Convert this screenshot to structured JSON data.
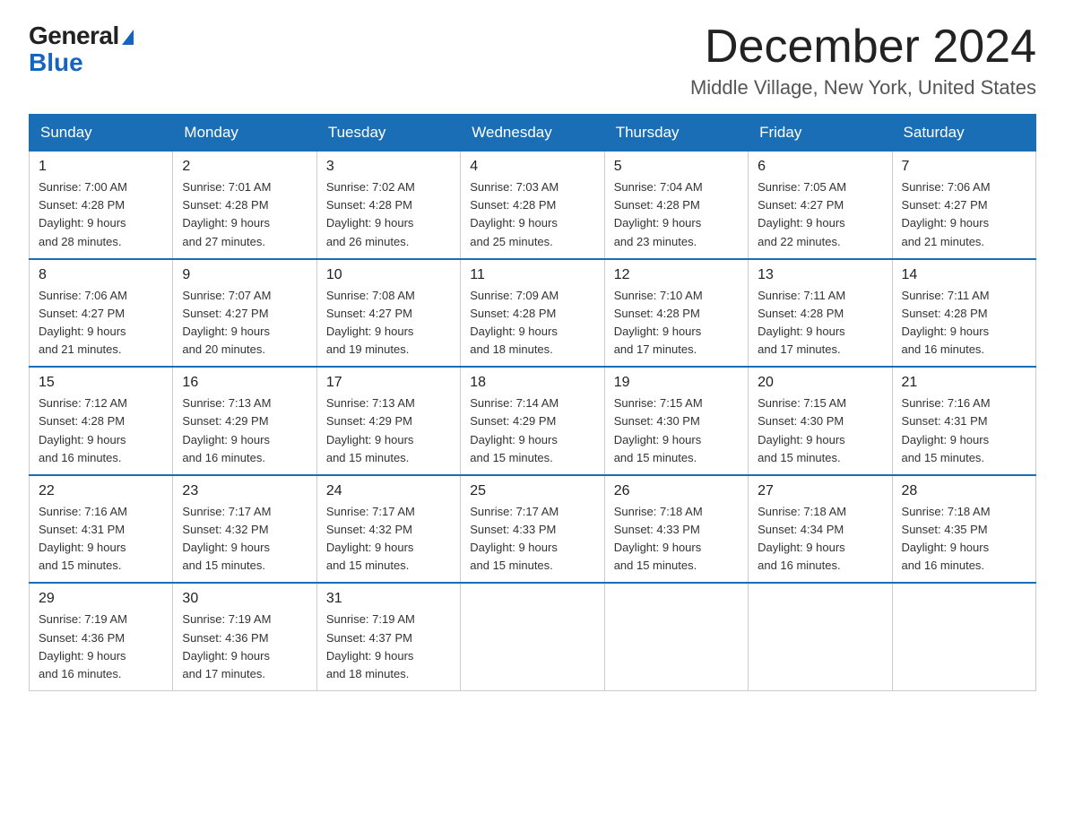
{
  "logo": {
    "general": "General",
    "triangle": "▶",
    "blue": "Blue"
  },
  "title": "December 2024",
  "subtitle": "Middle Village, New York, United States",
  "weekdays": [
    "Sunday",
    "Monday",
    "Tuesday",
    "Wednesday",
    "Thursday",
    "Friday",
    "Saturday"
  ],
  "weeks": [
    [
      {
        "day": "1",
        "sunrise": "7:00 AM",
        "sunset": "4:28 PM",
        "daylight": "9 hours and 28 minutes."
      },
      {
        "day": "2",
        "sunrise": "7:01 AM",
        "sunset": "4:28 PM",
        "daylight": "9 hours and 27 minutes."
      },
      {
        "day": "3",
        "sunrise": "7:02 AM",
        "sunset": "4:28 PM",
        "daylight": "9 hours and 26 minutes."
      },
      {
        "day": "4",
        "sunrise": "7:03 AM",
        "sunset": "4:28 PM",
        "daylight": "9 hours and 25 minutes."
      },
      {
        "day": "5",
        "sunrise": "7:04 AM",
        "sunset": "4:28 PM",
        "daylight": "9 hours and 23 minutes."
      },
      {
        "day": "6",
        "sunrise": "7:05 AM",
        "sunset": "4:27 PM",
        "daylight": "9 hours and 22 minutes."
      },
      {
        "day": "7",
        "sunrise": "7:06 AM",
        "sunset": "4:27 PM",
        "daylight": "9 hours and 21 minutes."
      }
    ],
    [
      {
        "day": "8",
        "sunrise": "7:06 AM",
        "sunset": "4:27 PM",
        "daylight": "9 hours and 21 minutes."
      },
      {
        "day": "9",
        "sunrise": "7:07 AM",
        "sunset": "4:27 PM",
        "daylight": "9 hours and 20 minutes."
      },
      {
        "day": "10",
        "sunrise": "7:08 AM",
        "sunset": "4:27 PM",
        "daylight": "9 hours and 19 minutes."
      },
      {
        "day": "11",
        "sunrise": "7:09 AM",
        "sunset": "4:28 PM",
        "daylight": "9 hours and 18 minutes."
      },
      {
        "day": "12",
        "sunrise": "7:10 AM",
        "sunset": "4:28 PM",
        "daylight": "9 hours and 17 minutes."
      },
      {
        "day": "13",
        "sunrise": "7:11 AM",
        "sunset": "4:28 PM",
        "daylight": "9 hours and 17 minutes."
      },
      {
        "day": "14",
        "sunrise": "7:11 AM",
        "sunset": "4:28 PM",
        "daylight": "9 hours and 16 minutes."
      }
    ],
    [
      {
        "day": "15",
        "sunrise": "7:12 AM",
        "sunset": "4:28 PM",
        "daylight": "9 hours and 16 minutes."
      },
      {
        "day": "16",
        "sunrise": "7:13 AM",
        "sunset": "4:29 PM",
        "daylight": "9 hours and 16 minutes."
      },
      {
        "day": "17",
        "sunrise": "7:13 AM",
        "sunset": "4:29 PM",
        "daylight": "9 hours and 15 minutes."
      },
      {
        "day": "18",
        "sunrise": "7:14 AM",
        "sunset": "4:29 PM",
        "daylight": "9 hours and 15 minutes."
      },
      {
        "day": "19",
        "sunrise": "7:15 AM",
        "sunset": "4:30 PM",
        "daylight": "9 hours and 15 minutes."
      },
      {
        "day": "20",
        "sunrise": "7:15 AM",
        "sunset": "4:30 PM",
        "daylight": "9 hours and 15 minutes."
      },
      {
        "day": "21",
        "sunrise": "7:16 AM",
        "sunset": "4:31 PM",
        "daylight": "9 hours and 15 minutes."
      }
    ],
    [
      {
        "day": "22",
        "sunrise": "7:16 AM",
        "sunset": "4:31 PM",
        "daylight": "9 hours and 15 minutes."
      },
      {
        "day": "23",
        "sunrise": "7:17 AM",
        "sunset": "4:32 PM",
        "daylight": "9 hours and 15 minutes."
      },
      {
        "day": "24",
        "sunrise": "7:17 AM",
        "sunset": "4:32 PM",
        "daylight": "9 hours and 15 minutes."
      },
      {
        "day": "25",
        "sunrise": "7:17 AM",
        "sunset": "4:33 PM",
        "daylight": "9 hours and 15 minutes."
      },
      {
        "day": "26",
        "sunrise": "7:18 AM",
        "sunset": "4:33 PM",
        "daylight": "9 hours and 15 minutes."
      },
      {
        "day": "27",
        "sunrise": "7:18 AM",
        "sunset": "4:34 PM",
        "daylight": "9 hours and 16 minutes."
      },
      {
        "day": "28",
        "sunrise": "7:18 AM",
        "sunset": "4:35 PM",
        "daylight": "9 hours and 16 minutes."
      }
    ],
    [
      {
        "day": "29",
        "sunrise": "7:19 AM",
        "sunset": "4:36 PM",
        "daylight": "9 hours and 16 minutes."
      },
      {
        "day": "30",
        "sunrise": "7:19 AM",
        "sunset": "4:36 PM",
        "daylight": "9 hours and 17 minutes."
      },
      {
        "day": "31",
        "sunrise": "7:19 AM",
        "sunset": "4:37 PM",
        "daylight": "9 hours and 18 minutes."
      },
      null,
      null,
      null,
      null
    ]
  ],
  "labels": {
    "sunrise": "Sunrise:",
    "sunset": "Sunset:",
    "daylight": "Daylight:"
  }
}
